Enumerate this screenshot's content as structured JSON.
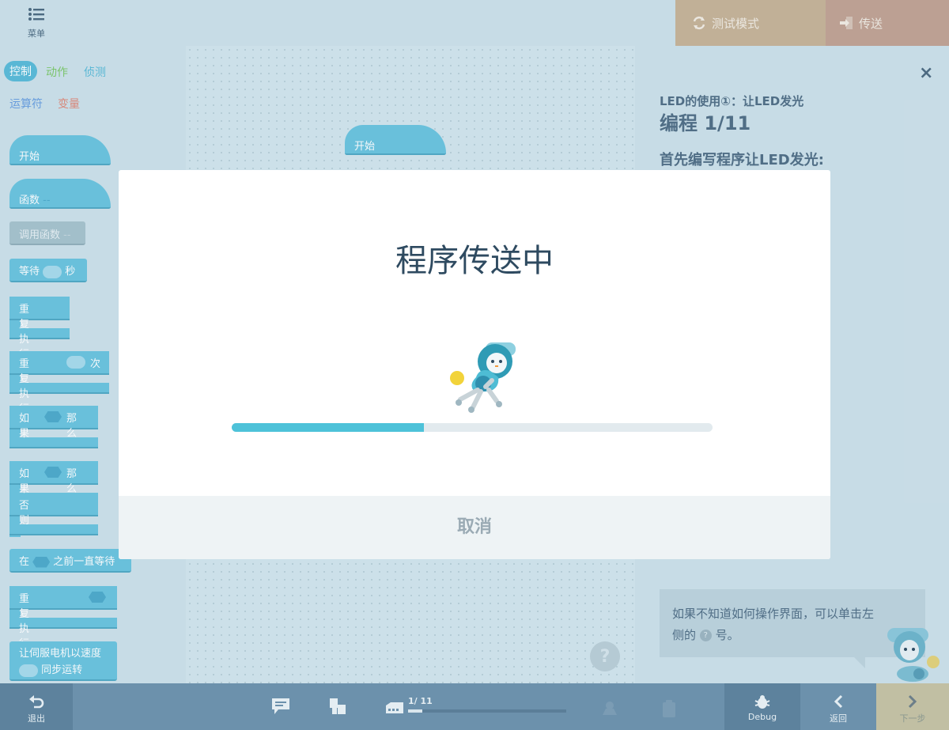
{
  "topbar": {
    "menu_label": "菜单",
    "test_mode_label": "测试模式",
    "send_label": "传送"
  },
  "palette": {
    "categories": [
      "控制",
      "动作",
      "侦测",
      "运算符",
      "变量"
    ],
    "category_colors": [
      "#5bbbd8",
      "#7fc96a",
      "#5bbbd8",
      "#6a9fe0",
      "#e08a7a"
    ],
    "blocks": {
      "start": "开始",
      "function": "函数",
      "function_suffix": "--",
      "call_function": "调用函数",
      "call_function_suffix": "--",
      "wait_a": "等待",
      "wait_b": "秒",
      "repeat": "重复执行",
      "repeat_n_a": "重复执行",
      "repeat_n_b": "次",
      "if_a": "如果",
      "if_b": "那么",
      "ifelse_a": "如果",
      "ifelse_b": "那么",
      "ifelse_else": "否则",
      "wait_until_a": "在",
      "wait_until_b": "之前一直等待",
      "repeat_until": "重复执行直到",
      "servo_a": "让伺服电机以速度",
      "servo_b": "同步运转"
    }
  },
  "canvas": {
    "start_block": "开始",
    "help": "?"
  },
  "lesson": {
    "subtitle": "LED的使用①：让LED发光",
    "title": "编程 1/11",
    "instruction": "首先编写程序让LED发光:",
    "tip_a": "如果不知道如何操作界面，可以单击左",
    "tip_b": "侧的",
    "tip_q": "?",
    "tip_c": "号。",
    "close": "×"
  },
  "bottombar": {
    "exit_label": "退出",
    "step_count": "1/ 11",
    "step_progress": 0.09,
    "debug_label": "Debug",
    "back_label": "返回",
    "next_label": "下一步"
  },
  "modal": {
    "title": "程序传送中",
    "progress": 0.4,
    "cancel_label": "取消"
  }
}
